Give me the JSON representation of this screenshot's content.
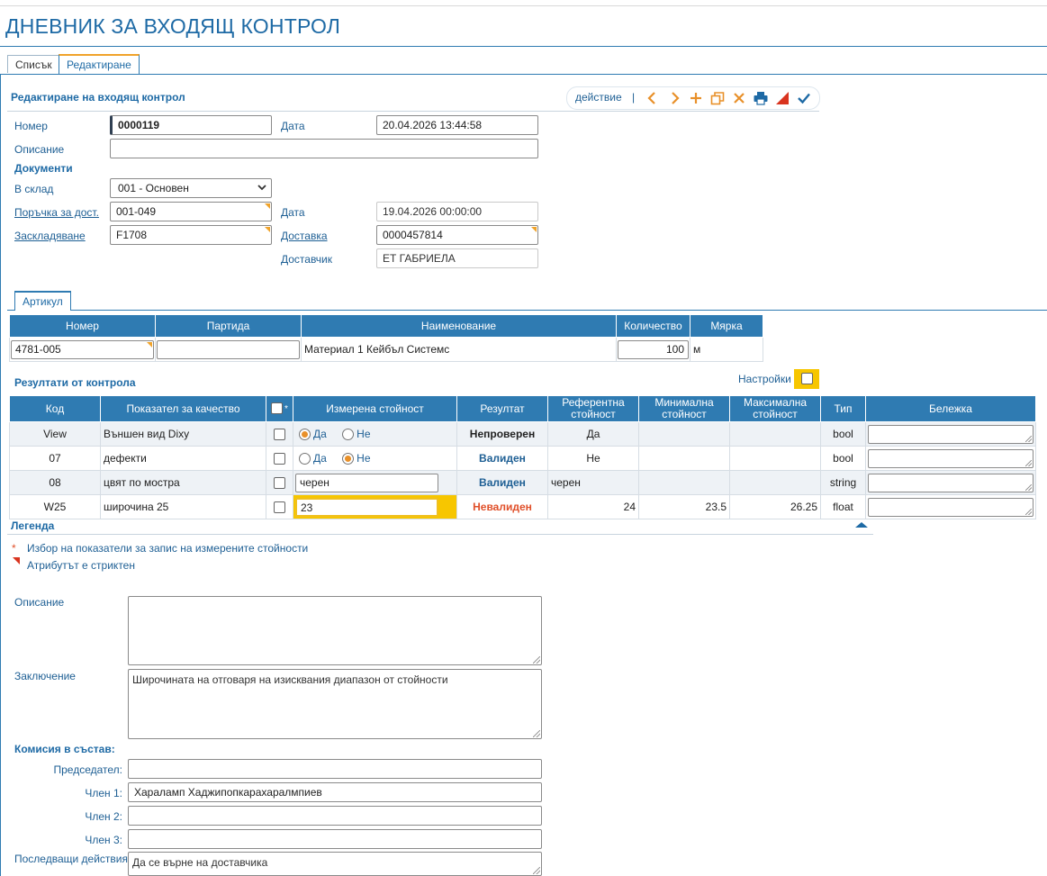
{
  "page": {
    "title": "ДНЕВНИК ЗА ВХОДЯЩ КОНТРОЛ"
  },
  "tabs": [
    {
      "label": "Списък"
    },
    {
      "label": "Редактиране"
    }
  ],
  "header": {
    "section_title": "Редактиране на входящ контрол",
    "toolbar": {
      "action_label": "действие",
      "separator": "|"
    },
    "number_label": "Номер",
    "number_value": "0000119",
    "date_label": "Дата",
    "date_value": "20.04.2026 13:44:58",
    "description_label": "Описание",
    "description_value": ""
  },
  "documents": {
    "title": "Документи",
    "warehouse_label": "В склад",
    "warehouse_value": "001 - Основен",
    "order_label": "Поръчка за дост.",
    "order_value": "001-049",
    "order_date_label": "Дата",
    "order_date_value": "19.04.2026 00:00:00",
    "booking_label": "Заскладяване",
    "booking_value": "F1708",
    "delivery_label": "Доставка",
    "delivery_value": "0000457814",
    "supplier_label": "Доставчик",
    "supplier_value": "ЕТ ГАБРИЕЛА"
  },
  "article": {
    "tab_label": "Артикул",
    "headers": [
      "Номер",
      "Партида",
      "Наименование",
      "Количество",
      "Мярка"
    ],
    "row": {
      "number": "4781-005",
      "batch": "",
      "name": "Материал 1 Кейбъл Системс",
      "quantity": "100",
      "unit": "м"
    }
  },
  "results": {
    "title": "Резултати от контрола",
    "settings_label": "Настройки",
    "headers": {
      "code": "Код",
      "indicator": "Показател за качество",
      "star": "*",
      "measured": "Измерена стойност",
      "result": "Резултат",
      "ref1": "Референтна",
      "ref2": "стойност",
      "min1": "Минимална",
      "min2": "стойност",
      "max1": "Максимална",
      "max2": "стойност",
      "type": "Тип",
      "note": "Бележка"
    },
    "yes_label": "Да",
    "no_label": "Не",
    "rows": [
      {
        "code": "View",
        "indicator": "Външен вид Dixy",
        "kind": "radio",
        "selected": "yes",
        "result": "Непроверен",
        "ref": "Да",
        "min": "",
        "max": "",
        "type": "bool"
      },
      {
        "code": "07",
        "indicator": "дефекти",
        "kind": "radio",
        "selected": "no",
        "result": "Валиден",
        "ref": "Не",
        "min": "",
        "max": "",
        "type": "bool"
      },
      {
        "code": "08",
        "indicator": "цвят по мостра",
        "kind": "text",
        "value": "черен",
        "result": "Валиден",
        "ref": "черен",
        "min": "",
        "max": "",
        "type": "string"
      },
      {
        "code": "W25",
        "indicator": "широчина 25",
        "kind": "text",
        "value": "23",
        "result": "Невалиден",
        "ref": "24",
        "min": "23.5",
        "max": "26.25",
        "type": "float"
      }
    ]
  },
  "legend": {
    "title": "Легенда",
    "star_mark": "*",
    "star_text": "Избор на показатели за запис на измерените стойности",
    "strict_text": "Атрибутът е стриктен"
  },
  "footer": {
    "description_label": "Описание",
    "description_value": "",
    "conclusion_label": "Заключение",
    "conclusion_value": "Широчината на отговаря на изисквания диапазон от стойности",
    "commission_title": "Комисия в състав:",
    "chairman_label": "Председател:",
    "chairman_value": "",
    "member1_label": "Член 1:",
    "member1_value": "Хараламп Хаджипопкарахаралмпиев",
    "member2_label": "Член 2:",
    "member2_value": "",
    "member3_label": "Член 3:",
    "member3_value": "",
    "followup_label": "Последващи действия",
    "followup_value": "Да се върне на доставчика"
  },
  "colors": {
    "primary": "#2f7bb2",
    "accent": "#f0a32a",
    "highlight": "#f7c600",
    "invalid": "#e0502a"
  }
}
